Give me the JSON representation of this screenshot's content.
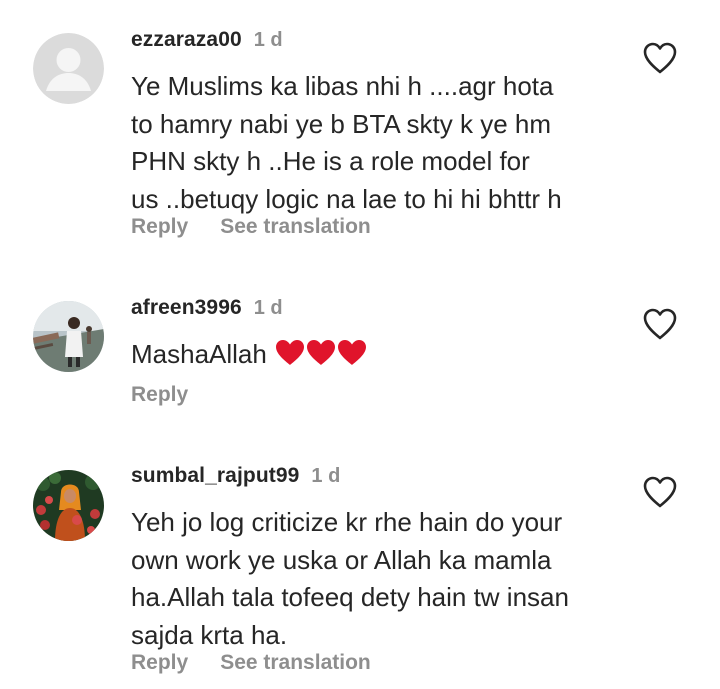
{
  "comments": [
    {
      "username": "ezzaraza00",
      "time": "1 d",
      "text": "Ye Muslims ka libas nhi h ....agr hota\nto hamry nabi ye b BTA skty k ye hm\nPHN skty h ..He is a role model for\nus ..betuqy logic na lae to hi hi bhttr h",
      "reply_label": "Reply",
      "translate_label": "See translation",
      "avatar": "default-avatar",
      "like_icon": "heart-outline-icon"
    },
    {
      "username": "afreen3996",
      "time": "1 d",
      "text": "MashaAllah",
      "emoji": [
        "red-heart",
        "red-heart",
        "red-heart"
      ],
      "reply_label": "Reply",
      "avatar": "photo-avatar",
      "like_icon": "heart-outline-icon"
    },
    {
      "username": "sumbal_rajput99",
      "time": "1 d",
      "text": "Yeh jo log criticize kr rhe hain do your\nown work ye uska or Allah ka mamla\nha.Allah tala tofeeq dety hain tw insan\nsajda krta ha.",
      "reply_label": "Reply",
      "translate_label": "See translation",
      "avatar": "photo-avatar",
      "like_icon": "heart-outline-icon"
    }
  ],
  "colors": {
    "primary_text": "#262626",
    "secondary_text": "#8e8e8e",
    "emoji_heart": "#e0142b"
  }
}
